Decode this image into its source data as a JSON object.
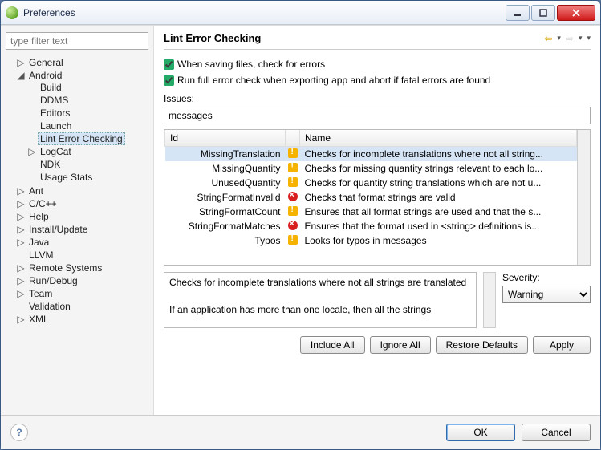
{
  "window": {
    "title": "Preferences"
  },
  "filter": {
    "placeholder": "type filter text"
  },
  "tree": [
    {
      "label": "General",
      "expandable": true,
      "expanded": false
    },
    {
      "label": "Android",
      "expandable": true,
      "expanded": true,
      "children": [
        {
          "label": "Build"
        },
        {
          "label": "DDMS"
        },
        {
          "label": "Editors"
        },
        {
          "label": "Launch"
        },
        {
          "label": "Lint Error Checking",
          "selected": true
        },
        {
          "label": "LogCat",
          "expandable": true,
          "expanded": false
        },
        {
          "label": "NDK"
        },
        {
          "label": "Usage Stats"
        }
      ]
    },
    {
      "label": "Ant",
      "expandable": true,
      "expanded": false
    },
    {
      "label": "C/C++",
      "expandable": true,
      "expanded": false
    },
    {
      "label": "Help",
      "expandable": true,
      "expanded": false
    },
    {
      "label": "Install/Update",
      "expandable": true,
      "expanded": false
    },
    {
      "label": "Java",
      "expandable": true,
      "expanded": false
    },
    {
      "label": "LLVM"
    },
    {
      "label": "Remote Systems",
      "expandable": true,
      "expanded": false
    },
    {
      "label": "Run/Debug",
      "expandable": true,
      "expanded": false
    },
    {
      "label": "Team",
      "expandable": true,
      "expanded": false
    },
    {
      "label": "Validation"
    },
    {
      "label": "XML",
      "expandable": true,
      "expanded": false
    }
  ],
  "page": {
    "title": "Lint Error Checking",
    "check_on_save": "When saving files, check for errors",
    "check_on_export": "Run full error check when exporting app and abort if fatal errors are found",
    "issues_label": "Issues:",
    "filter_value": "messages",
    "columns": {
      "id": "Id",
      "name": "Name"
    },
    "rows": [
      {
        "id": "MissingTranslation",
        "sev": "warn",
        "name": "Checks for incomplete translations where not all string...",
        "selected": true
      },
      {
        "id": "MissingQuantity",
        "sev": "warn",
        "name": "Checks for missing quantity strings relevant to each lo..."
      },
      {
        "id": "UnusedQuantity",
        "sev": "warn",
        "name": "Checks for quantity string translations which are not u..."
      },
      {
        "id": "StringFormatInvalid",
        "sev": "err",
        "name": "Checks that format strings are valid"
      },
      {
        "id": "StringFormatCount",
        "sev": "warn",
        "name": "Ensures that all format strings are used and that the s..."
      },
      {
        "id": "StringFormatMatches",
        "sev": "err",
        "name": "Ensures that the format used in <string> definitions is..."
      },
      {
        "id": "Typos",
        "sev": "warn",
        "name": "Looks for typos in messages"
      }
    ],
    "detail": "Checks for incomplete translations where not all strings are translated\n\nIf an application has more than one locale, then all the strings",
    "severity_label": "Severity:",
    "severity_value": "Warning",
    "buttons": {
      "include_all": "Include All",
      "ignore_all": "Ignore All",
      "restore": "Restore Defaults",
      "apply": "Apply",
      "ok": "OK",
      "cancel": "Cancel"
    }
  }
}
